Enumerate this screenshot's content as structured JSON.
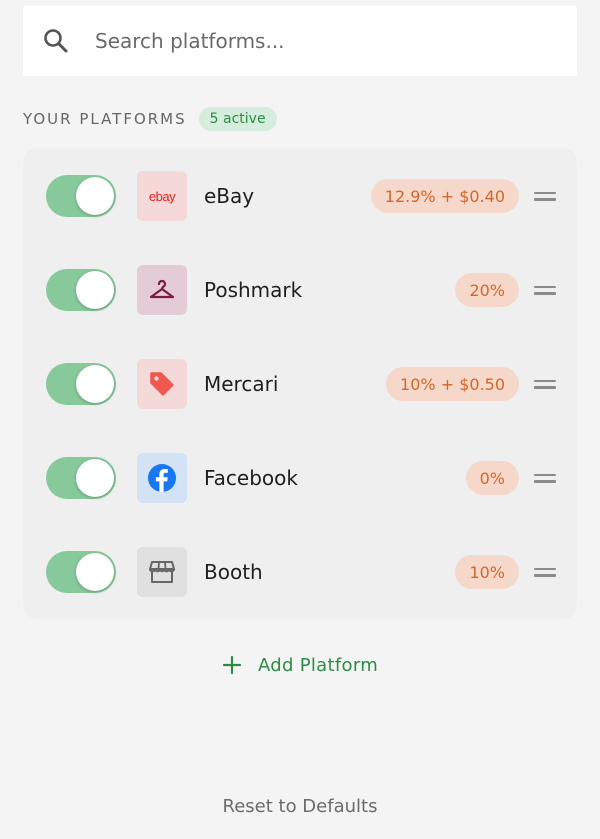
{
  "search": {
    "placeholder": "Search platforms...",
    "value": ""
  },
  "section": {
    "title": "YOUR PLATFORMS",
    "active_count": "5 active"
  },
  "platforms": [
    {
      "name": "eBay",
      "fee": "12.9% + $0.40",
      "enabled": true,
      "icon": "ebay-logo",
      "logo_text": "ebay",
      "logo_bg": "#f5d9d9"
    },
    {
      "name": "Poshmark",
      "fee": "20%",
      "enabled": true,
      "icon": "hanger-icon",
      "logo_bg": "#e3ccd6"
    },
    {
      "name": "Mercari",
      "fee": "10% + $0.50",
      "enabled": true,
      "icon": "price-tag-icon",
      "logo_bg": "#f5d9d9"
    },
    {
      "name": "Facebook",
      "fee": "0%",
      "enabled": true,
      "icon": "facebook-icon",
      "logo_bg": "#d4e2f5"
    },
    {
      "name": "Booth",
      "fee": "10%",
      "enabled": true,
      "icon": "storefront-icon",
      "logo_bg": "#e0e0e0"
    }
  ],
  "actions": {
    "add_label": "Add Platform",
    "reset_label": "Reset to Defaults"
  },
  "colors": {
    "accent_green": "#2e8b45",
    "toggle_on": "#87c99a",
    "fee_bg": "#f6d8ca",
    "fee_text": "#d2672a",
    "ebay_red": "#e2231a",
    "poshmark": "#7d1a44",
    "mercari_red": "#f0574f",
    "facebook_blue": "#1877f2"
  }
}
